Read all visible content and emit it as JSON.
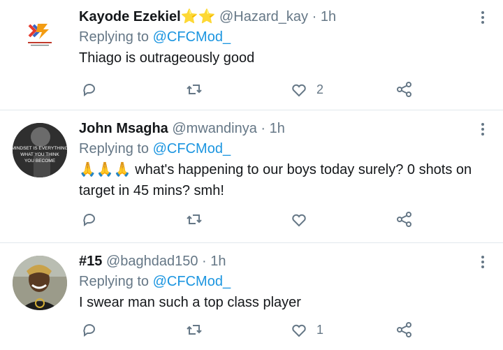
{
  "tweets": [
    {
      "name": "Kayode Ezekiel",
      "badges": "⭐⭐",
      "handle": "@Hazard_kay",
      "dot": "·",
      "time": "1h",
      "replying_prefix": "Replying to ",
      "replying_to": "@CFCMod_",
      "text": "Thiago is outrageously good",
      "likes": "2"
    },
    {
      "name": "John Msagha",
      "handle": "@mwandinya",
      "dot": "·",
      "time": "1h",
      "replying_prefix": "Replying to ",
      "replying_to": "@CFCMod_",
      "text": "🙏🙏🙏 what's happening to our boys today surely? 0 shots on target in 45 mins? smh!",
      "likes": "",
      "avatar_text": "MINDSET IS EVERYTHING WHAT YOU THINK YOU BECOME"
    },
    {
      "name": "#15",
      "handle": "@baghdad150",
      "dot": "·",
      "time": "1h",
      "replying_prefix": "Replying to ",
      "replying_to": "@CFCMod_",
      "text": "I swear man such a top class player",
      "likes": "1"
    }
  ],
  "colors": {
    "link": "#1b95e0",
    "muted": "#657786",
    "text": "#14171a"
  },
  "icons": [
    "reply-icon",
    "retweet-icon",
    "like-icon",
    "share-icon",
    "more-options-icon"
  ]
}
